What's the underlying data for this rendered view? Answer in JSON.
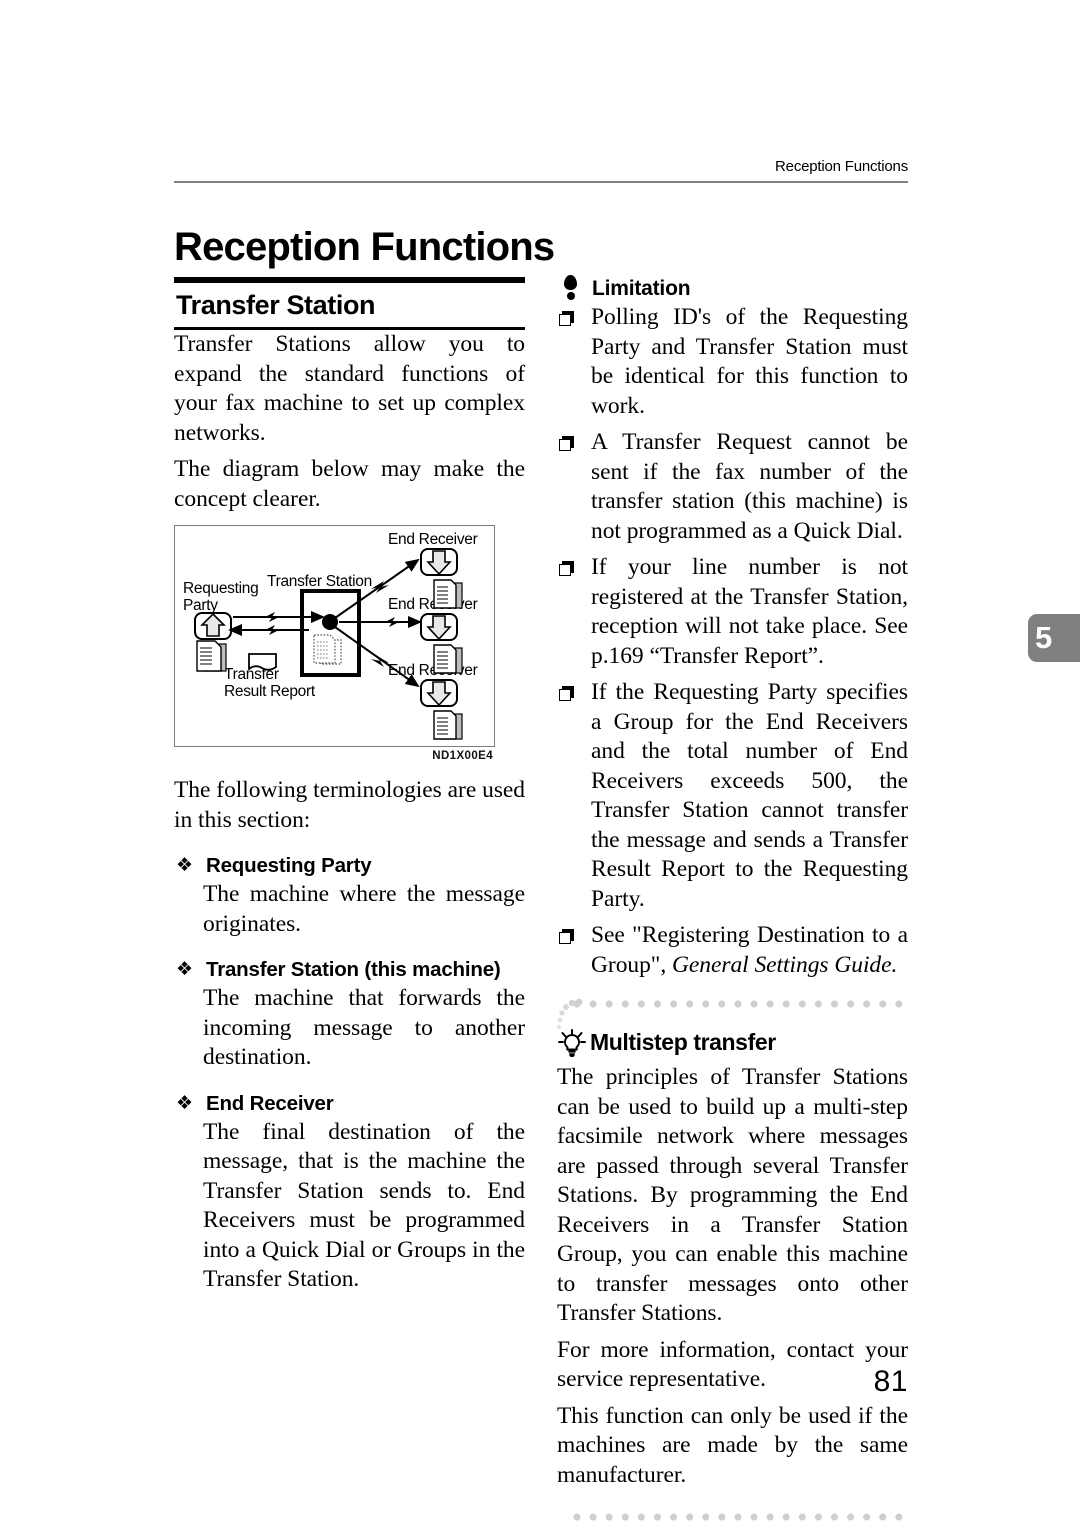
{
  "page": {
    "running_head": "Reception Functions",
    "chapter_title": "Reception Functions",
    "chapter_tab": "5",
    "page_number": "81"
  },
  "left_column": {
    "section_heading": "Transfer Station",
    "intro_paragraph_1": "Transfer Stations allow you to expand the standard functions of your fax machine to set up complex networks.",
    "intro_paragraph_2": "The diagram below may make the concept clearer.",
    "figure": {
      "id": "ND1X00E4",
      "labels": {
        "requesting_party": "Requesting\nParty",
        "requesting_party_line1": "Requesting",
        "requesting_party_line2": "Party",
        "transfer_station": "Transfer Station",
        "transfer_result_report_line1": "Transfer",
        "transfer_result_report_line2": "Result Report",
        "end_receiver_1": "End Receiver",
        "end_receiver_2": "End Receiver",
        "end_receiver_3": "End Receiver"
      }
    },
    "terminology_intro": "The following terminologies are used in this section:",
    "terms": [
      {
        "icon": "diamond-bullet-icon",
        "title": "Requesting Party",
        "body": "The machine where the message originates."
      },
      {
        "icon": "diamond-bullet-icon",
        "title": "Transfer Station (this machine)",
        "body": "The machine that forwards the incoming message to another destination."
      },
      {
        "icon": "diamond-bullet-icon",
        "title": "End Receiver",
        "body": "The final destination of the message, that is the machine the Transfer Station sends to. End Receivers must be programmed into a Quick Dial or Groups in the Transfer Station."
      }
    ]
  },
  "right_column": {
    "limitation": {
      "icon": "exclamation-icon",
      "title": "Limitation",
      "items": [
        "Polling ID's of the Requesting Party and Transfer Station must be identical for this function to work.",
        "A Transfer Request cannot be sent if the fax number of the transfer station (this machine) is not programmed as a Quick Dial.",
        "If your line number is not registered at the Transfer Station, reception will not take place. See p.169 “Transfer Report”.",
        "If the Requesting Party specifies a Group for the End Receivers and the total number of End Receivers exceeds 500, the Transfer Station cannot transfer the message and sends a Transfer Result Report to the Requesting Party."
      ],
      "last_item_prefix": "See \"Registering Destination to a Group\", ",
      "last_item_italic": "General Settings Guide."
    },
    "multistep": {
      "icon": "lightbulb-icon",
      "title": "Multistep transfer",
      "paragraphs": [
        "The principles of Transfer Stations can be used to build up a multi-step facsimile network where messages are passed through several Transfer Stations. By programming the End Receivers in a Transfer Station Group, you can enable this machine to transfer messages onto other Transfer Stations.",
        "For more information, contact your service representative.",
        "This function can only be used if the machines are made by the same manufacturer."
      ]
    }
  },
  "colors": {
    "rule_gray": "#808080",
    "tab_gray": "#808080",
    "dot_gray": "#cfcfcf",
    "figure_border": "#7d7d7d",
    "text": "#000000"
  }
}
